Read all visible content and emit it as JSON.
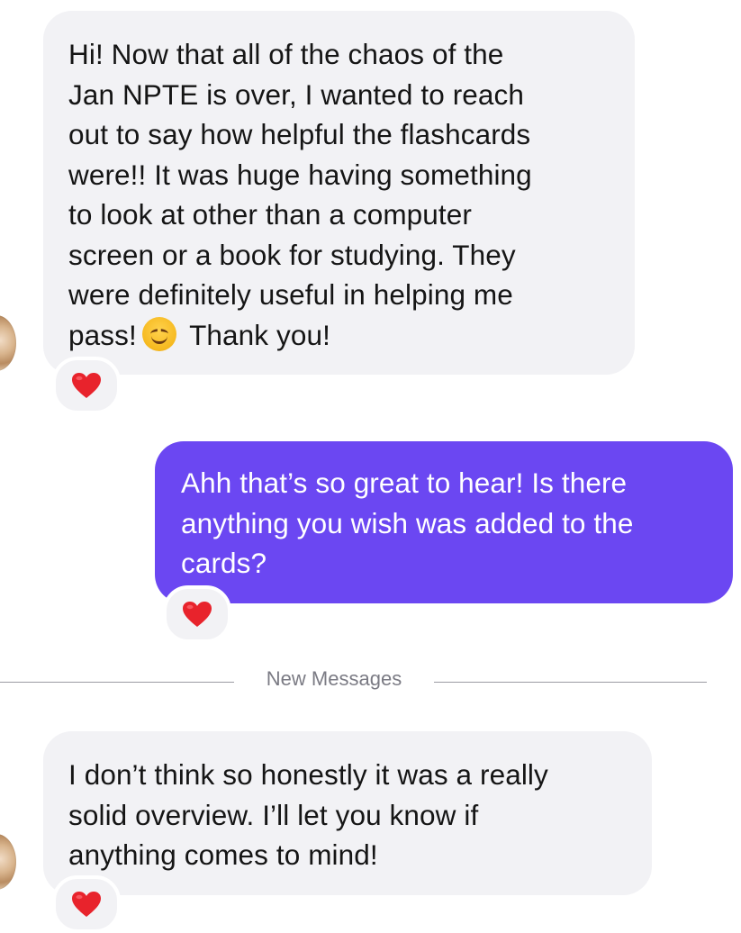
{
  "messages": [
    {
      "direction": "incoming",
      "text_before_emoji": "Hi! Now that all of the chaos of the\nJan NPTE is over, I wanted to reach\nout to say how helpful the flashcards\nwere!! It was huge having something\nto look at other than a computer\nscreen or a book for studying. They\nwere definitely useful in helping me\npass!",
      "emoji": "smiling-face-icon",
      "text_after_emoji": "Thank you!",
      "reaction": "red-heart-icon"
    },
    {
      "direction": "outgoing",
      "text": "Ahh that’s so great to hear! Is there\nanything you wish was added to the\ncards?",
      "reaction": "red-heart-icon"
    },
    {
      "direction": "incoming",
      "text": "I don’t think so honestly it was a really\nsolid overview. I’ll let you know if\nanything comes to mind!",
      "reaction": "red-heart-icon"
    }
  ],
  "divider": {
    "label": "New Messages"
  },
  "colors": {
    "incoming_bubble": "#f2f2f5",
    "outgoing_bubble": "#6b47f2",
    "heart": "#e8232c",
    "divider": "#9b9ba3"
  }
}
